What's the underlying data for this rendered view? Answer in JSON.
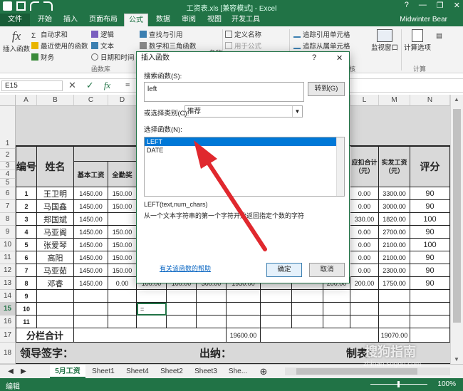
{
  "window": {
    "title": "工资表.xls [兼容模式] - Excel",
    "controls": [
      "?",
      "—",
      "❐",
      "✕"
    ]
  },
  "ribbon_tabs": [
    "文件",
    "开始",
    "插入",
    "页面布局",
    "公式",
    "数据",
    "审阅",
    "视图",
    "开发工具"
  ],
  "active_tab": "公式",
  "user": "Midwinter Bear",
  "ribbon": {
    "insert_function": "插入函数",
    "autosum": "自动求和",
    "recent": "最近使用的函数",
    "financial": "财务",
    "logical": "逻辑",
    "text": "文本",
    "datetime": "日期和时间",
    "lookup": "查找与引用",
    "math": "数学和三角函数",
    "group_library": "函数库",
    "define_name": "定义名称",
    "use_in_formula": "用于公式",
    "trace_precedents": "追踪引用单元格",
    "trace_dependents": "追踪从属单元格",
    "watch_window": "监视窗口",
    "calc_options": "计算选项",
    "group_calc": "计算",
    "name_manager_partial": "名称",
    "audit_partial": "核"
  },
  "formula_bar": {
    "name_box": "E15",
    "cancel": "✕",
    "enter": "✓",
    "fx": "fx",
    "content": "="
  },
  "columns": [
    "A",
    "B",
    "C",
    "D",
    "E",
    "F",
    "G",
    "H",
    "I",
    "J",
    "K",
    "L",
    "M",
    "N"
  ],
  "rows": [
    "1",
    "2",
    "3",
    "4",
    "5",
    "6",
    "7",
    "8",
    "9",
    "10",
    "11",
    "12",
    "13",
    "14",
    "15",
    "16",
    "17",
    "18"
  ],
  "table": {
    "header": {
      "id": "编号",
      "name": "姓名",
      "base": "基本工资",
      "attendance": "全勤奖",
      "payable": "应扣合计（元）",
      "actual": "实发工资（元）",
      "score": "评分"
    },
    "records": [
      {
        "id": "1",
        "name": "王卫明",
        "base": "1450.00",
        "att": "150.00",
        "deduct": "0.00",
        "actual": "3300.00",
        "score": "90"
      },
      {
        "id": "2",
        "name": "马国鑫",
        "base": "1450.00",
        "att": "150.00",
        "deduct": "0.00",
        "actual": "3000.00",
        "score": "90"
      },
      {
        "id": "3",
        "name": "郑国斌",
        "base": "1450.00",
        "att": "",
        "deduct": "330.00",
        "actual": "1820.00",
        "score": "100"
      },
      {
        "id": "4",
        "name": "马亚阁",
        "base": "1450.00",
        "att": "150.00",
        "deduct": "0.00",
        "actual": "2700.00",
        "score": "90"
      },
      {
        "id": "5",
        "name": "张爱琴",
        "base": "1450.00",
        "att": "150.00",
        "deduct": "0.00",
        "actual": "2100.00",
        "score": "100"
      },
      {
        "id": "6",
        "name": "高阳",
        "base": "1450.00",
        "att": "150.00",
        "deduct": "0.00",
        "actual": "2100.00",
        "score": "90"
      },
      {
        "id": "7",
        "name": "马亚茹",
        "base": "1450.00",
        "att": "150.00",
        "deduct": "0.00",
        "actual": "2300.00",
        "score": "90"
      },
      {
        "id": "8",
        "name": "邓睿",
        "base": "1450.00",
        "att": "0.00",
        "deduct": "200.00",
        "actual": "1750.00",
        "score": "90"
      }
    ],
    "row13_hidden_vals": [
      "100.00",
      "100.00",
      "300.00",
      "1950.00",
      "200.00"
    ],
    "extra_ids": [
      "9",
      "10",
      "11"
    ],
    "subtotal_label": "分栏合计",
    "subtotal_mid": "19600.00",
    "subtotal_actual": "19070.00",
    "sign_leader": "领导签字：",
    "sign_cashier": "出纳：",
    "sign_maker": "制表："
  },
  "sheet_tabs": [
    "5月工资",
    "Sheet1",
    "Sheet4",
    "Sheet2",
    "Sheet3",
    "She..."
  ],
  "active_sheet": "5月工资",
  "status": {
    "mode": "编辑",
    "zoom": "100%"
  },
  "dialog": {
    "title": "插入函数",
    "help": "?",
    "close": "✕",
    "search_label": "搜索函数(S):",
    "search_value": "left",
    "go_button": "转到(G)",
    "category_label": "或选择类别(C):",
    "category_value": "推荐",
    "select_label": "选择函数(N):",
    "functions": [
      "LEFT",
      "DATE"
    ],
    "selected_function": "LEFT",
    "syntax": "LEFT(text,num_chars)",
    "description": "从一个文本字符串的第一个字符开始返回指定个数的字符",
    "help_link": "有关该函数的帮助",
    "ok": "确定",
    "cancel": "取消"
  },
  "watermark": {
    "main": "搜狗指南",
    "sub": "zhinan.sogou.com"
  },
  "colors": {
    "excel_green": "#217346",
    "arrow_red": "#e0282e",
    "selection_blue": "#0078d7"
  }
}
